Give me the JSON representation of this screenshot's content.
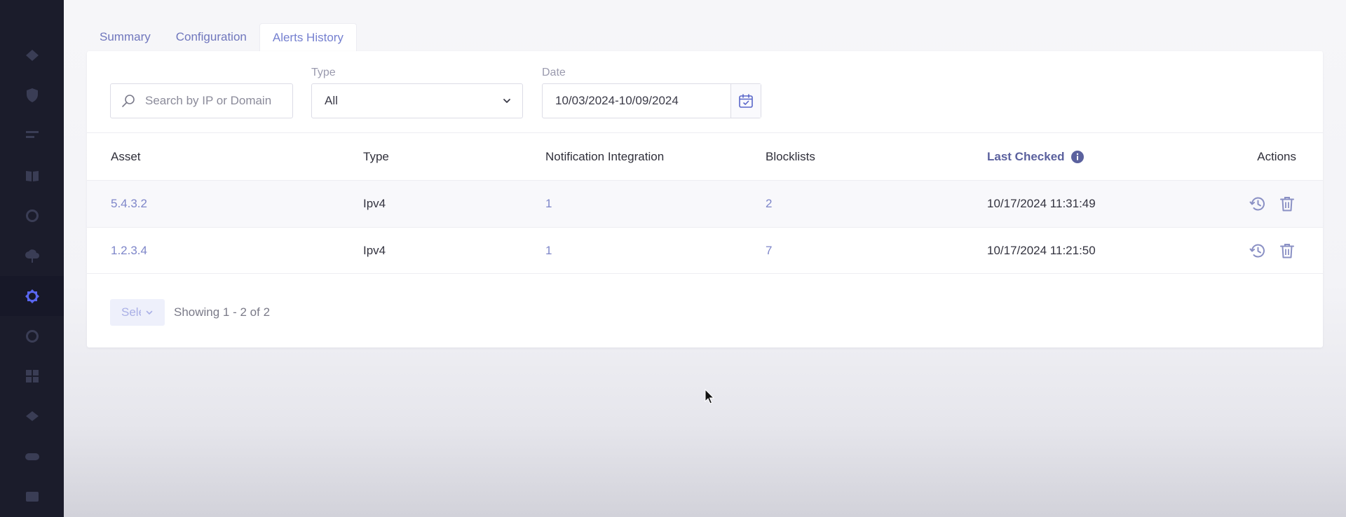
{
  "sidebar": {
    "items": [
      {
        "icon": "layers-icon"
      },
      {
        "icon": "shield-check-icon"
      },
      {
        "icon": "server-list-icon"
      },
      {
        "icon": "book-icon"
      },
      {
        "icon": "circle-icon"
      },
      {
        "icon": "cloud-upload-icon"
      },
      {
        "icon": "badge-icon",
        "active": true
      },
      {
        "icon": "search-circle-icon"
      },
      {
        "icon": "grid-icon"
      },
      {
        "icon": "stack-icon"
      },
      {
        "icon": "toggle-icon"
      },
      {
        "icon": "video-icon"
      }
    ]
  },
  "tabs": [
    {
      "label": "Summary"
    },
    {
      "label": "Configuration"
    },
    {
      "label": "Alerts History",
      "active": true
    }
  ],
  "filters": {
    "search_placeholder": "Search by IP or Domain",
    "type_label": "Type",
    "type_value": "All",
    "date_label": "Date",
    "date_value": "10/03/2024-10/09/2024"
  },
  "table": {
    "headers": {
      "asset": "Asset",
      "type": "Type",
      "notification": "Notification Integration",
      "blocklists": "Blocklists",
      "last_checked": "Last Checked",
      "actions": "Actions"
    },
    "rows": [
      {
        "asset": "5.4.3.2",
        "type": "Ipv4",
        "notification": "1",
        "blocklists": "2",
        "last_checked": "10/17/2024 11:31:49"
      },
      {
        "asset": "1.2.3.4",
        "type": "Ipv4",
        "notification": "1",
        "blocklists": "7",
        "last_checked": "10/17/2024 11:21:50"
      }
    ]
  },
  "pager": {
    "page_size_text": "Sele",
    "showing": "Showing 1 - 2 of 2"
  },
  "colors": {
    "sidebar_bg": "#1b1c2b",
    "accent": "#5966f0",
    "link": "#7e86c9"
  }
}
